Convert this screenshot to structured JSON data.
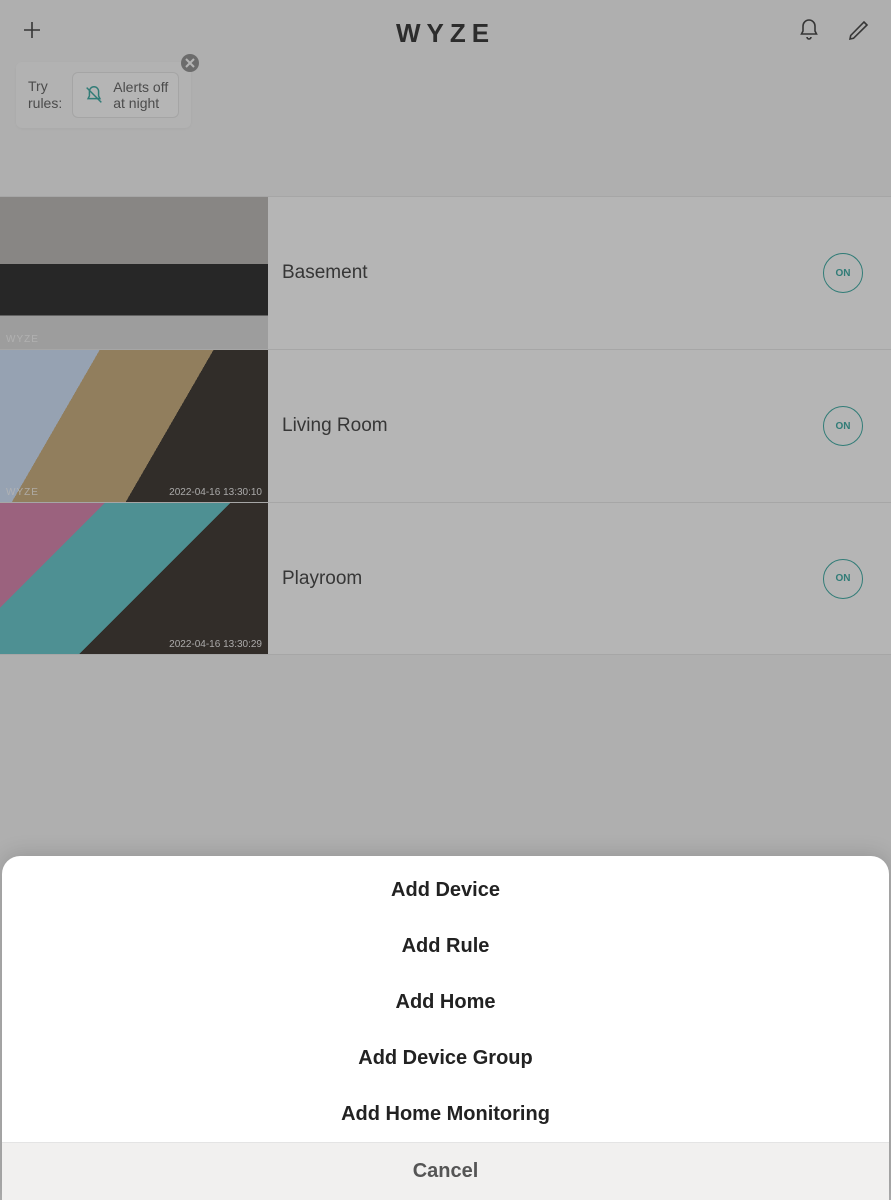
{
  "brand": "WYZE",
  "tip": {
    "label_line1": "Try",
    "label_line2": "rules:",
    "rule_line1": "Alerts off",
    "rule_line2": "at night"
  },
  "devices": [
    {
      "name": "Basement",
      "state": "ON",
      "watermark": "WYZE",
      "timestamp": ""
    },
    {
      "name": "Living Room",
      "state": "ON",
      "watermark": "WYZE",
      "timestamp": "2022-04-16 13:30:10"
    },
    {
      "name": "Playroom",
      "state": "ON",
      "watermark": "",
      "timestamp": "2022-04-16 13:30:29"
    }
  ],
  "sheet": {
    "options": [
      "Add Device",
      "Add Rule",
      "Add Home",
      "Add Device Group",
      "Add Home Monitoring"
    ],
    "cancel": "Cancel"
  }
}
